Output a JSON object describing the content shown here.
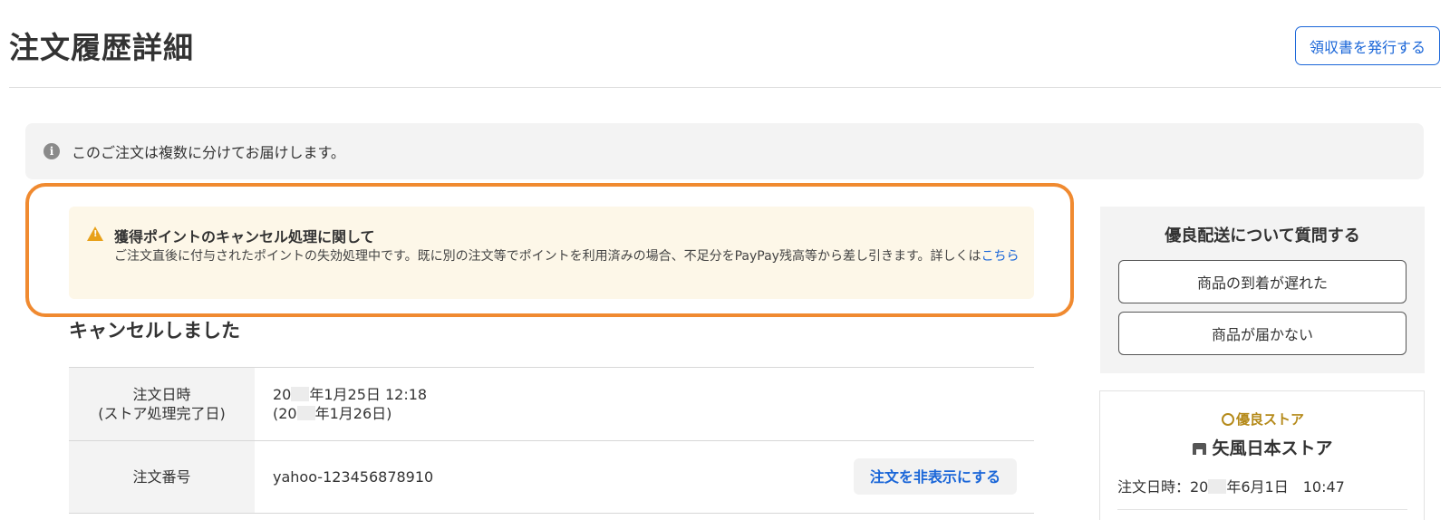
{
  "header": {
    "title": "注文履歴詳細",
    "receipt_button": "領収書を発行する"
  },
  "info_banner": {
    "icon": "info-icon",
    "text": "このご注文は複数に分けてお届けします。"
  },
  "points_notice": {
    "icon": "warning-icon",
    "title": "獲得ポイントのキャンセル処理に関して",
    "body": "ご注文直後に付与されたポイントの失効処理中です。既に別の注文等でポイントを利用済みの場合、不足分をPayPay残高等から差し引きます。詳しくは",
    "link": "こちら"
  },
  "order": {
    "status_heading": "キャンセルしました",
    "date_label_line1": "注文日時",
    "date_label_line2": "(ストア処理完了日)",
    "date_value_prefix": "20",
    "date_value_suffix": "年1月25日 12:18",
    "complete_value_prefix": "(20",
    "complete_value_suffix": "年1月26日)",
    "id_label": "注文番号",
    "id_value": "yahoo-123456878910",
    "hide_button": "注文を非表示にする"
  },
  "faq": {
    "title": "優良配送について質問する",
    "buttons": [
      "商品の到着が遅れた",
      "商品が届かない"
    ]
  },
  "store": {
    "badge": "優良ストア",
    "name": "矢風日本ストア",
    "date_prefix": "注文日時：20",
    "date_suffix": "年6月1日　10:47"
  },
  "colors": {
    "accent": "#1a66d8",
    "highlight": "#f08a30",
    "warning": "#e8a11a",
    "badge": "#b58a1a"
  }
}
